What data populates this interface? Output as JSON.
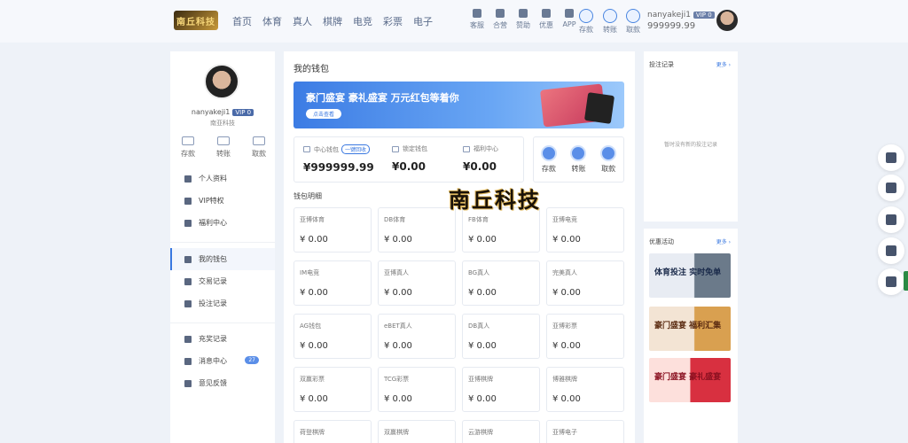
{
  "header": {
    "logo_text": "南丘科技",
    "nav": [
      "首页",
      "体育",
      "真人",
      "棋牌",
      "电竞",
      "彩票",
      "电子"
    ],
    "tools": [
      {
        "label": "客服",
        "icon": "headset-icon"
      },
      {
        "label": "合营",
        "icon": "handshake-icon"
      },
      {
        "label": "赞助",
        "icon": "trophy-icon"
      },
      {
        "label": "优惠",
        "icon": "gift-icon"
      },
      {
        "label": "APP",
        "icon": "phone-icon"
      }
    ],
    "funds": [
      {
        "label": "存款",
        "icon": "deposit-icon"
      },
      {
        "label": "转账",
        "icon": "transfer-icon"
      },
      {
        "label": "取款",
        "icon": "withdraw-icon"
      }
    ],
    "username": "nanyakeji1",
    "vip": "VIP 0",
    "balance": "999999.99"
  },
  "sidebar": {
    "username": "nanyakeji1",
    "vip": "VIP 0",
    "subtitle": "南亚科技",
    "actions": [
      "存款",
      "转账",
      "取款"
    ],
    "menu_group1": [
      "个人资料",
      "VIP特权",
      "福利中心"
    ],
    "menu_group2": [
      "我的钱包",
      "交易记录",
      "投注记录"
    ],
    "menu_group3": [
      "充奖记录",
      "消息中心",
      "意见反馈"
    ],
    "message_badge": "27"
  },
  "main": {
    "title": "我的钱包",
    "banner_text": "豪门盛宴 豪礼盛宴 万元红包等着你",
    "banner_button": "点击查看",
    "wallets": [
      {
        "label": "中心钱包",
        "tag": "一键回收",
        "value": "¥999999.99"
      },
      {
        "label": "锁定钱包",
        "tag": "",
        "value": "¥0.00"
      },
      {
        "label": "福利中心",
        "tag": "",
        "value": "¥0.00"
      }
    ],
    "wallet_actions": [
      "存款",
      "转账",
      "取款"
    ],
    "detail_title": "钱包明细",
    "venues": [
      {
        "name": "亚博体育",
        "value": "¥ 0.00"
      },
      {
        "name": "DB体育",
        "value": "¥ 0.00"
      },
      {
        "name": "FB体育",
        "value": "¥ 0.00"
      },
      {
        "name": "亚博电竞",
        "value": "¥ 0.00"
      },
      {
        "name": "IM电竞",
        "value": "¥ 0.00"
      },
      {
        "name": "亚博真人",
        "value": "¥ 0.00"
      },
      {
        "name": "BG真人",
        "value": "¥ 0.00"
      },
      {
        "name": "完美真人",
        "value": "¥ 0.00"
      },
      {
        "name": "AG钱包",
        "value": "¥ 0.00"
      },
      {
        "name": "eBET真人",
        "value": "¥ 0.00"
      },
      {
        "name": "DB真人",
        "value": "¥ 0.00"
      },
      {
        "name": "亚博彩票",
        "value": "¥ 0.00"
      },
      {
        "name": "双赢彩票",
        "value": "¥ 0.00"
      },
      {
        "name": "TCG彩票",
        "value": "¥ 0.00"
      },
      {
        "name": "亚博棋牌",
        "value": "¥ 0.00"
      },
      {
        "name": "博雅棋牌",
        "value": "¥ 0.00"
      },
      {
        "name": "荷登棋牌",
        "value": ""
      },
      {
        "name": "双赢棋牌",
        "value": ""
      },
      {
        "name": "云游棋牌",
        "value": ""
      },
      {
        "name": "亚博电子",
        "value": ""
      }
    ]
  },
  "watermark": "南丘科技",
  "right": {
    "bets_title": "投注记录",
    "bets_more": "更多 ›",
    "bets_empty": "暂时没有新的投注记录",
    "promo_title": "优惠活动",
    "promo_more": "更多 ›",
    "promos": [
      "体育投注 实时免单",
      "豪门盛宴 福利汇集",
      "豪门盛宴 豪礼盛宴"
    ]
  }
}
